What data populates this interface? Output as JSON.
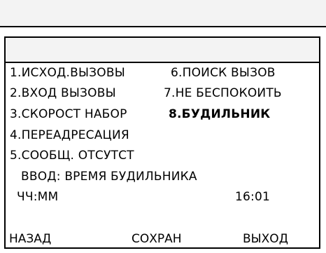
{
  "menu": {
    "left": [
      "1.ИСХОД.ВЫЗОВЫ",
      "2.ВХОД ВЫЗОВЫ",
      "3.СКОРОСТ НАБОР",
      "4.ПЕРЕАДРЕСАЦИЯ",
      "5.СООБЩ. ОТСУТСТ"
    ],
    "right": [
      "6.ПОИСК ВЫЗОВ",
      "7.НЕ БЕСПОКОИТЬ",
      "8.БУДИЛЬНИК"
    ],
    "selected": "8.БУДИЛЬНИК"
  },
  "input": {
    "prompt": "ВВОД: ВРЕМЯ БУДИЛЬНИКА",
    "format": "ЧЧ:ММ",
    "value": "16:01"
  },
  "softkeys": {
    "back": "НАЗАД",
    "save": "СОХРАН",
    "exit": "ВЫХОД"
  }
}
